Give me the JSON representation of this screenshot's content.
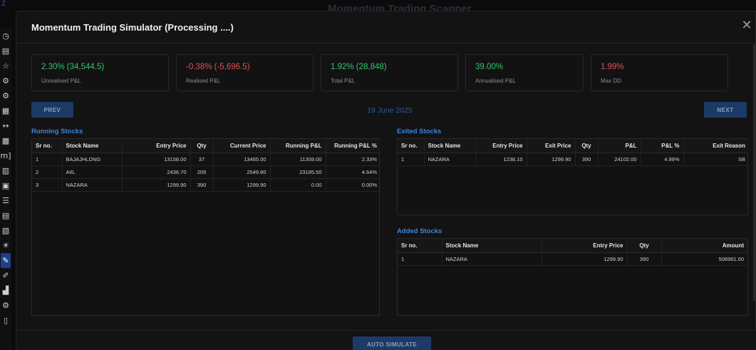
{
  "backdrop": {
    "title": "Momentum Trading Scanner",
    "logo": "Z"
  },
  "sidebar": {
    "icons": [
      {
        "name": "speedometer-icon",
        "glyph": "◷"
      },
      {
        "name": "chart-board-icon",
        "glyph": "▤"
      },
      {
        "name": "star-icon",
        "glyph": "☆"
      },
      {
        "name": "gear-outline-icon",
        "glyph": "⚙"
      },
      {
        "name": "settings-icon",
        "glyph": "⚙"
      },
      {
        "name": "calculator-icon",
        "glyph": "▦"
      },
      {
        "name": "arrows-horizontal-icon",
        "glyph": "↔"
      },
      {
        "name": "keyboard-icon",
        "glyph": "▩"
      },
      {
        "name": "bracket-m-icon",
        "glyph": "m]"
      },
      {
        "name": "grid-window-icon",
        "glyph": "▥"
      },
      {
        "name": "scanner-icon",
        "glyph": "▣"
      },
      {
        "name": "list-icon",
        "glyph": "☰"
      },
      {
        "name": "table-search-icon",
        "glyph": "▤"
      },
      {
        "name": "layers-icon",
        "glyph": "▧"
      },
      {
        "name": "bulb-icon",
        "glyph": "☀"
      },
      {
        "name": "simulator-icon",
        "glyph": "✎"
      },
      {
        "name": "pen-icon",
        "glyph": "✐"
      },
      {
        "name": "bar-chart-icon",
        "glyph": "▟"
      },
      {
        "name": "gear-alt-icon",
        "glyph": "⚙"
      },
      {
        "name": "document-icon",
        "glyph": "▯"
      }
    ],
    "active_index": 15
  },
  "modal": {
    "title": "Momentum Trading Simulator (Processing ....)",
    "close_glyph": "✕"
  },
  "stats": [
    {
      "value": "2.30% (34,544.5)",
      "label": "Unrealised P&L",
      "tone": "pos"
    },
    {
      "value": "-0.38% (-5,696.5)",
      "label": "Realised P&L",
      "tone": "neg"
    },
    {
      "value": "1.92% (28,848)",
      "label": "Total P&L",
      "tone": "pos"
    },
    {
      "value": "39.00%",
      "label": "Annualised P&L",
      "tone": "pos"
    },
    {
      "value": "1.99%",
      "label": "Max DD",
      "tone": "neg"
    }
  ],
  "nav": {
    "prev_label": "PREV",
    "next_label": "NEXT",
    "date": "19 June 2025"
  },
  "running": {
    "title": "Running Stocks",
    "columns": [
      "Sr no.",
      "Stock Name",
      "Entry Price",
      "Qty",
      "Current Price",
      "Running P&L",
      "Running P&L %"
    ],
    "rows": [
      [
        "1",
        "BAJAJHLDNG",
        "13158.00",
        "37",
        "13465.00",
        "11359.00",
        "2.33%"
      ],
      [
        "2",
        "AIIL",
        "2436.70",
        "205",
        "2549.80",
        "23185.50",
        "4.64%"
      ],
      [
        "3",
        "NAZARA",
        "1299.90",
        "390",
        "1299.90",
        "0.00",
        "0.00%"
      ]
    ]
  },
  "exited": {
    "title": "Exited Stocks",
    "columns": [
      "Sr no.",
      "Stock Name",
      "Entry Price",
      "Exit Price",
      "Qty",
      "P&L",
      "P&L %",
      "Exit Reason"
    ],
    "rows": [
      [
        "1",
        "NAZARA",
        "1238.10",
        "1299.90",
        "390",
        "24102.00",
        "4.99%",
        "SB"
      ]
    ]
  },
  "added": {
    "title": "Added Stocks",
    "columns": [
      "Sr no.",
      "Stock Name",
      "Entry Price",
      "Qty",
      "Amount"
    ],
    "rows": [
      [
        "1",
        "NAZARA",
        "1299.90",
        "390",
        "506961.00"
      ]
    ]
  },
  "footer": {
    "auto_simulate_label": "AUTO SIMULATE"
  },
  "colors": {
    "positive": "#36c46b",
    "negative": "#e05151",
    "accent": "#3d86d6",
    "button_bg": "#1d3a66"
  }
}
